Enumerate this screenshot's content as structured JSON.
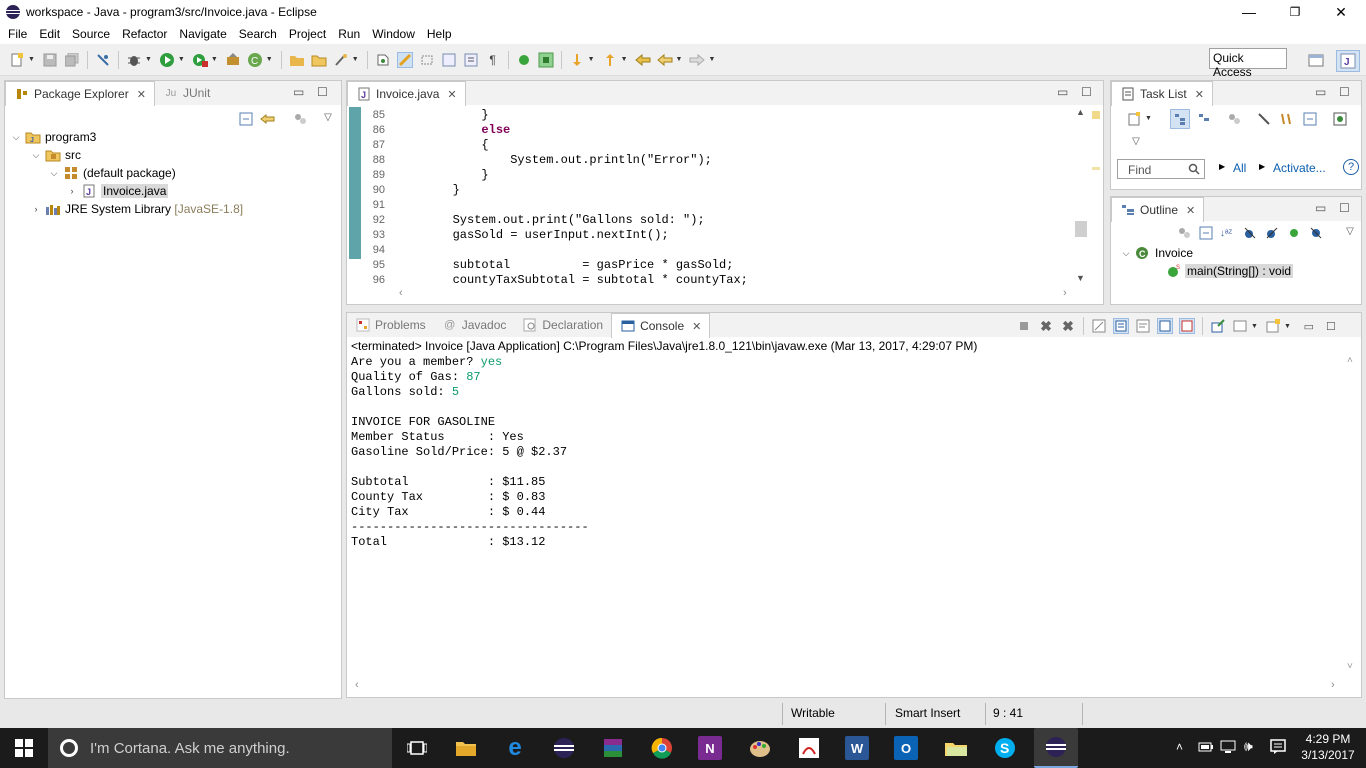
{
  "window": {
    "title": "workspace - Java - program3/src/Invoice.java - Eclipse",
    "minimize": "—",
    "restore": "❐",
    "close": "✕"
  },
  "menu": [
    "File",
    "Edit",
    "Source",
    "Refactor",
    "Navigate",
    "Search",
    "Project",
    "Run",
    "Window",
    "Help"
  ],
  "toolbar": {
    "quick_access": "Quick Access"
  },
  "package_explorer": {
    "tabs": [
      {
        "label": "Package Explorer",
        "close": "✕"
      },
      {
        "label": "JUnit"
      }
    ],
    "tree": {
      "project": "program3",
      "src": "src",
      "package": "(default package)",
      "file": "Invoice.java",
      "jre": "JRE System Library",
      "jre_version": "[JavaSE-1.8]"
    }
  },
  "editor": {
    "tab": "Invoice.java",
    "close": "✕",
    "lines": [
      {
        "no": "85",
        "code": "            }"
      },
      {
        "no": "86",
        "code": "            else"
      },
      {
        "no": "87",
        "code": "            {"
      },
      {
        "no": "88",
        "code": "                System.out.println(\"Error\");"
      },
      {
        "no": "89",
        "code": "            }"
      },
      {
        "no": "90",
        "code": "        }"
      },
      {
        "no": "91",
        "code": ""
      },
      {
        "no": "92",
        "code": "        System.out.print(\"Gallons sold: \");"
      },
      {
        "no": "93",
        "code": "        gasSold = userInput.nextInt();"
      },
      {
        "no": "94",
        "code": ""
      },
      {
        "no": "95",
        "code": "        subtotal          = gasPrice * gasSold;"
      },
      {
        "no": "96",
        "code": "        countyTaxSubtotal = subtotal * countyTax;"
      }
    ]
  },
  "task_list": {
    "tab": "Task List",
    "close": "✕",
    "find_placeholder": "Find",
    "all": "All",
    "activate": "Activate..."
  },
  "outline": {
    "tab": "Outline",
    "close": "✕",
    "class": "Invoice",
    "method": "main(String[]) : void"
  },
  "console_panel": {
    "tabs": [
      {
        "label": "Problems"
      },
      {
        "label": "Javadoc"
      },
      {
        "label": "Declaration"
      },
      {
        "label": "Console",
        "close": "✕"
      }
    ],
    "header": "<terminated> Invoice [Java Application] C:\\Program Files\\Java\\jre1.8.0_121\\bin\\javaw.exe (Mar 13, 2017, 4:29:07 PM)",
    "lines": [
      {
        "prefix": "Are you a member? ",
        "input": "yes"
      },
      {
        "prefix": "Quality of Gas: ",
        "input": "87"
      },
      {
        "prefix": "Gallons sold: ",
        "input": "5"
      },
      {
        "prefix": "",
        "input": ""
      },
      {
        "prefix": "INVOICE FOR GASOLINE",
        "input": ""
      },
      {
        "prefix": "Member Status      : Yes",
        "input": ""
      },
      {
        "prefix": "Gasoline Sold/Price: 5 @ $2.37",
        "input": ""
      },
      {
        "prefix": "",
        "input": ""
      },
      {
        "prefix": "Subtotal           : $11.85",
        "input": ""
      },
      {
        "prefix": "County Tax         : $ 0.83",
        "input": ""
      },
      {
        "prefix": "City Tax           : $ 0.44",
        "input": ""
      },
      {
        "prefix": "---------------------------------",
        "input": ""
      },
      {
        "prefix": "Total              : $13.12",
        "input": ""
      }
    ]
  },
  "status_bar": {
    "writable": "Writable",
    "insert_mode": "Smart Insert",
    "position": "9 : 41"
  },
  "taskbar": {
    "cortana": "I'm Cortana. Ask me anything.",
    "time": "4:29 PM",
    "date": "3/13/2017"
  }
}
